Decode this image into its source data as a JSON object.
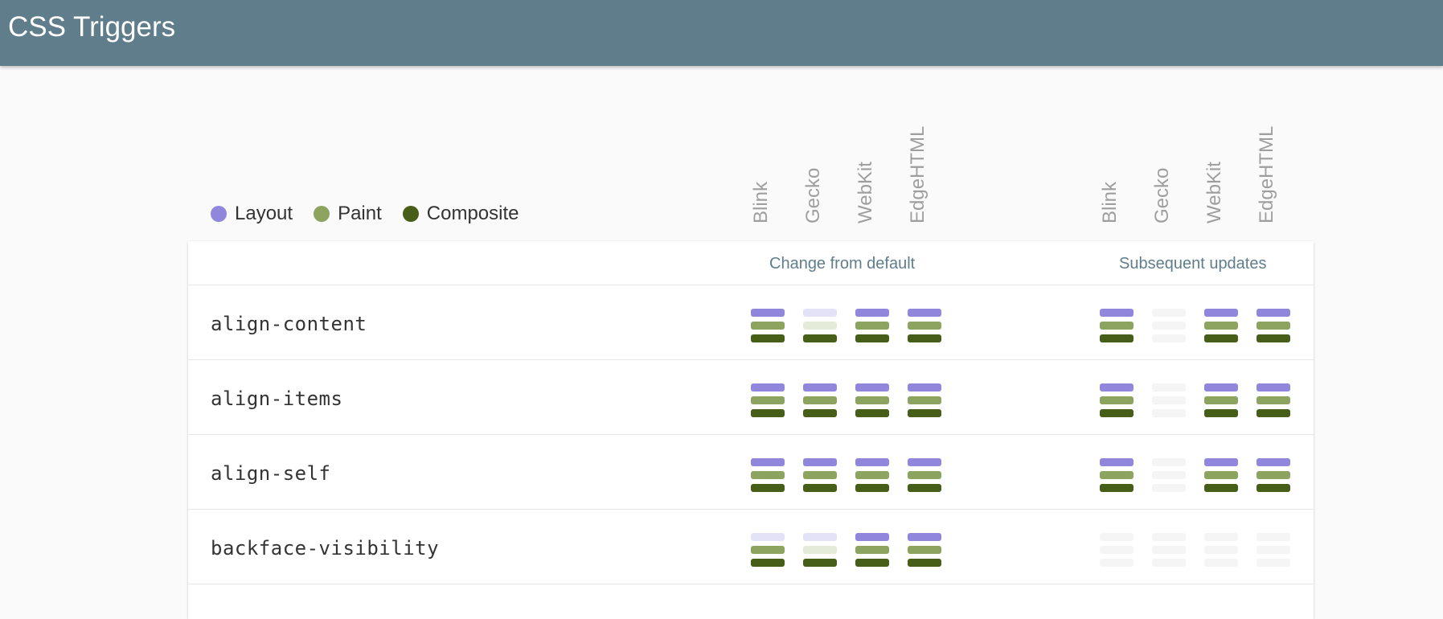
{
  "app": {
    "title": "CSS Triggers"
  },
  "legend": [
    {
      "label": "Layout",
      "key": "layout",
      "color": "#9087dd"
    },
    {
      "label": "Paint",
      "key": "paint",
      "color": "#8da360"
    },
    {
      "label": "Composite",
      "key": "composite",
      "color": "#475e18"
    }
  ],
  "engines": [
    "Blink",
    "Gecko",
    "WebKit",
    "EdgeHTML"
  ],
  "groups": {
    "change": "Change from default",
    "subsequent": "Subsequent updates"
  },
  "rows": [
    {
      "property": "align-content",
      "change": [
        [
          "on",
          "on",
          "on"
        ],
        [
          "faint",
          "faint",
          "on"
        ],
        [
          "on",
          "on",
          "on"
        ],
        [
          "on",
          "on",
          "on"
        ]
      ],
      "subsequent": [
        [
          "on",
          "on",
          "on"
        ],
        [
          "off",
          "off",
          "off"
        ],
        [
          "on",
          "on",
          "on"
        ],
        [
          "on",
          "on",
          "on"
        ]
      ]
    },
    {
      "property": "align-items",
      "change": [
        [
          "on",
          "on",
          "on"
        ],
        [
          "on",
          "on",
          "on"
        ],
        [
          "on",
          "on",
          "on"
        ],
        [
          "on",
          "on",
          "on"
        ]
      ],
      "subsequent": [
        [
          "on",
          "on",
          "on"
        ],
        [
          "off",
          "off",
          "off"
        ],
        [
          "on",
          "on",
          "on"
        ],
        [
          "on",
          "on",
          "on"
        ]
      ]
    },
    {
      "property": "align-self",
      "change": [
        [
          "on",
          "on",
          "on"
        ],
        [
          "on",
          "on",
          "on"
        ],
        [
          "on",
          "on",
          "on"
        ],
        [
          "on",
          "on",
          "on"
        ]
      ],
      "subsequent": [
        [
          "on",
          "on",
          "on"
        ],
        [
          "off",
          "off",
          "off"
        ],
        [
          "on",
          "on",
          "on"
        ],
        [
          "on",
          "on",
          "on"
        ]
      ]
    },
    {
      "property": "backface-visibility",
      "change": [
        [
          "faint",
          "on",
          "on"
        ],
        [
          "faint",
          "faint",
          "on"
        ],
        [
          "on",
          "on",
          "on"
        ],
        [
          "on",
          "on",
          "on"
        ]
      ],
      "subsequent": [
        [
          "off",
          "off",
          "off"
        ],
        [
          "off",
          "off",
          "off"
        ],
        [
          "off",
          "off",
          "off"
        ],
        [
          "off",
          "off",
          "off"
        ]
      ]
    }
  ]
}
